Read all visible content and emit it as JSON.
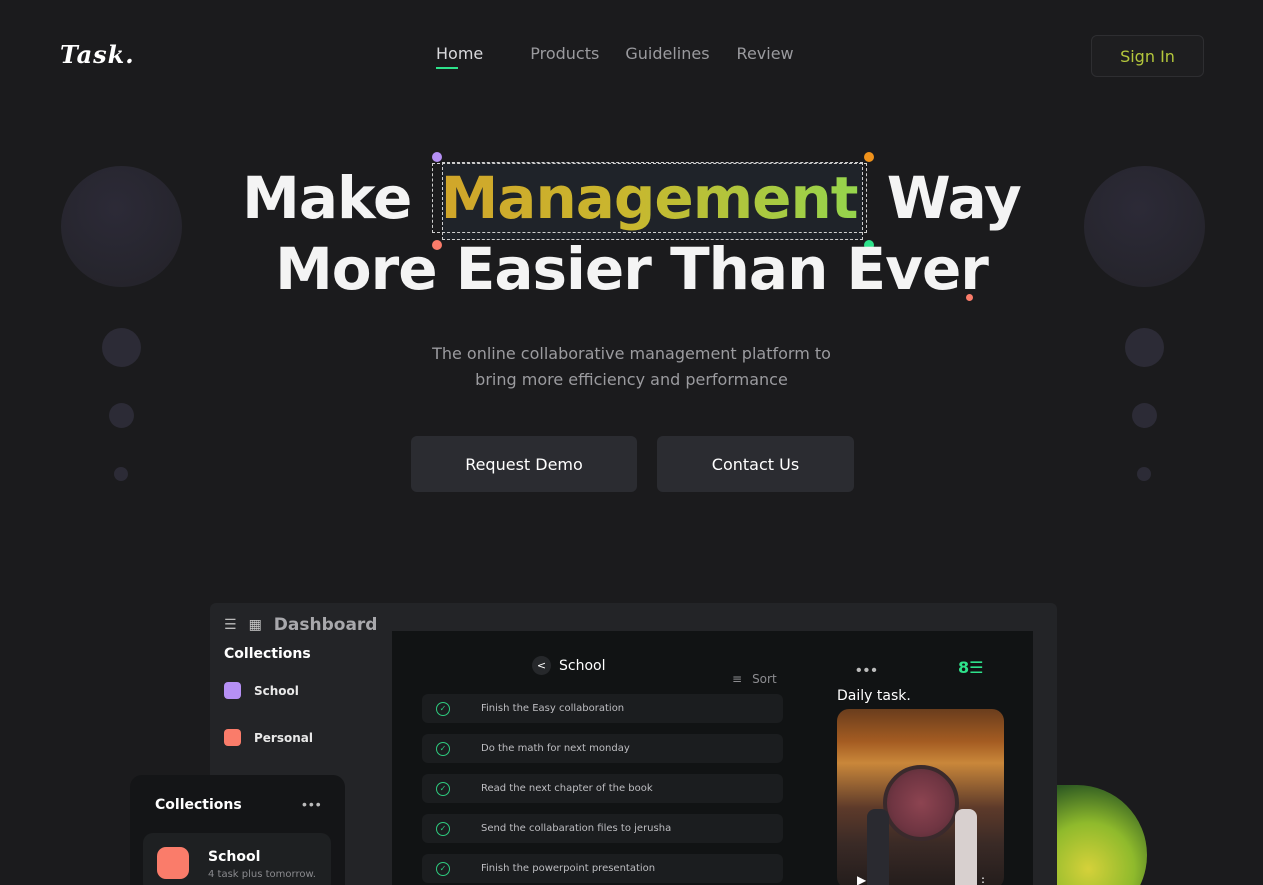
{
  "brand": {
    "logo": "Task."
  },
  "nav": {
    "items": [
      "Home",
      "Products",
      "Guidelines",
      "Review"
    ],
    "active": "Home",
    "sign_in": "Sign In"
  },
  "hero": {
    "line1_before": "Make",
    "line1_highlight": "Management",
    "line1_after": "Way",
    "line2": "More Easier Than Ever",
    "subtitle_line1": "The online collaborative management platform to",
    "subtitle_line2": "bring more efficiency and performance",
    "primary_button": "Request Demo",
    "secondary_button": "Contact Us"
  },
  "dashboard": {
    "title": "Dashboard",
    "collections_title": "Collections",
    "collections": [
      {
        "label": "School",
        "color": "#b690f5"
      },
      {
        "label": "Personal",
        "color": "#fa7c6a"
      }
    ],
    "list_title": "School",
    "sort_label": "Sort",
    "tasks": [
      "Finish the Easy collaboration",
      "Do the math for next monday",
      "Read the next chapter of the book",
      "Send the collabaration files to jerusha",
      "Finish the powerpoint presentation"
    ],
    "daily_title": "Daily task."
  },
  "card": {
    "title": "Collections",
    "item_name": "School",
    "item_sub": "4 task plus tomorrow."
  },
  "colors": {
    "accent_green": "#2ee28b",
    "sign_in_text": "#b4c73c",
    "background": "#1b1b1d"
  }
}
